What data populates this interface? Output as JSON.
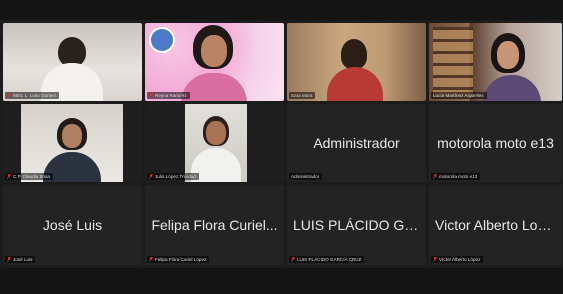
{
  "participants": {
    "p1": {
      "name": "Mtro. L. Lutio Gomez",
      "muted": true
    },
    "p2": {
      "name": "Reyna Ramirez",
      "muted": true
    },
    "p3": {
      "name": "Sara Mora",
      "muted": false
    },
    "p4": {
      "name": "Lucía Martínez Argüelles",
      "muted": false
    },
    "p5": {
      "name": "C.P. Claudia Sosa",
      "muted": true
    },
    "p6": {
      "name": "Julio López Trinidad",
      "muted": true
    },
    "p7": {
      "display": "Administrador",
      "name": "Administrador",
      "muted": false
    },
    "p8": {
      "display": "motorola moto e13",
      "name": "motorola moto e13",
      "muted": true
    },
    "p9": {
      "display": "José Luis",
      "name": "José Luis",
      "muted": true
    },
    "p10": {
      "display": "Felipa Flora Curiel...",
      "name": "Felipa Flora Curiel López",
      "muted": true
    },
    "p11": {
      "display": "LUIS PLÁCIDO GA...",
      "name": "LUIS PLÁCIDO GARCÍA CRUZ",
      "muted": true
    },
    "p12": {
      "display": "Victor Alberto Lopez",
      "name": "Víctor Alberto López",
      "muted": true
    }
  },
  "colors": {
    "mic_muted": "#e02f2f",
    "active_speaker": "#c9d94a",
    "tile_bg": "#232323"
  }
}
